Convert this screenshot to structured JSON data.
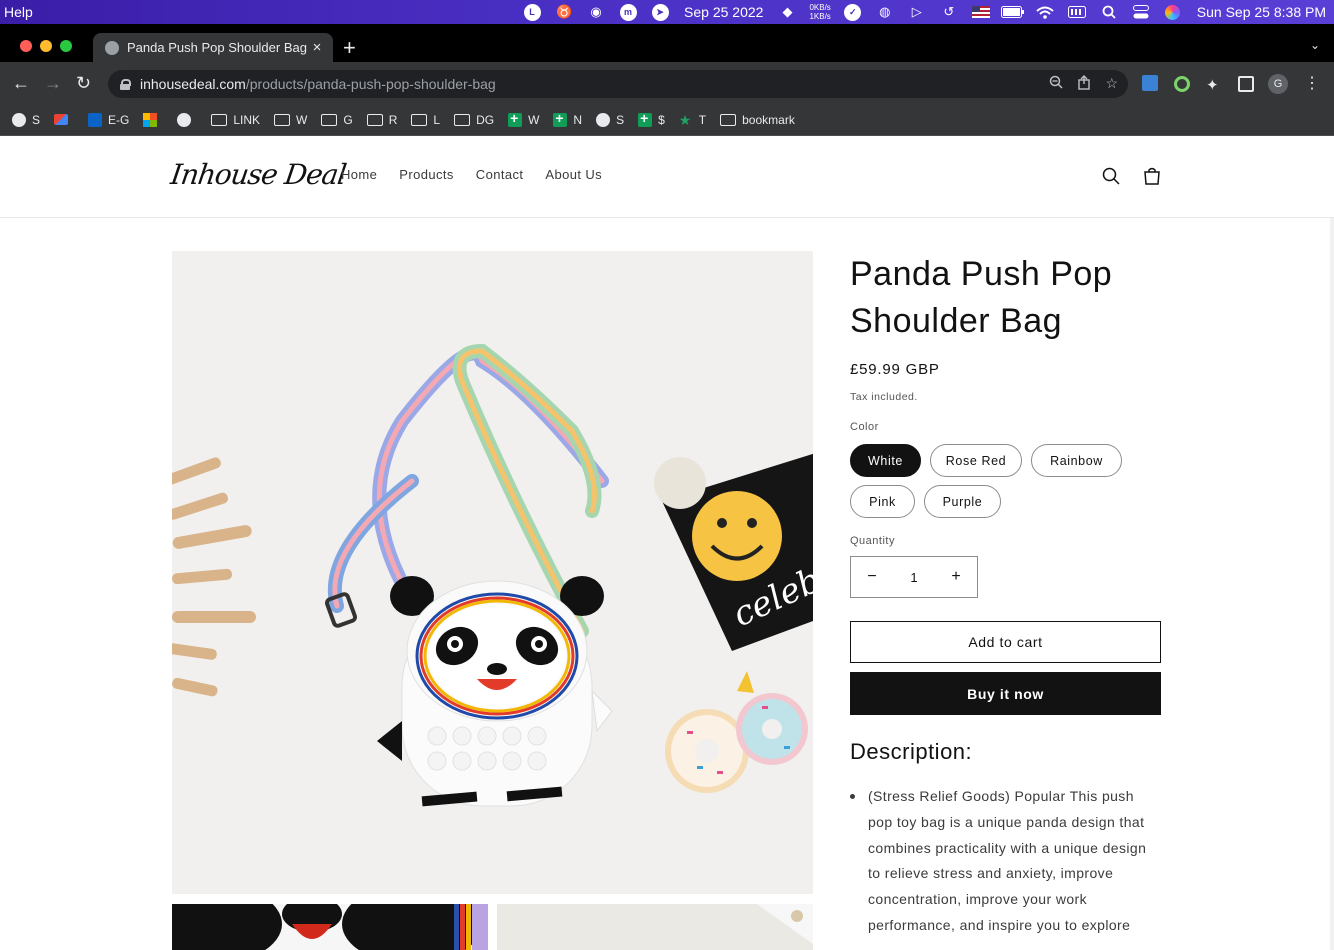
{
  "menubar": {
    "app_menu": "Help",
    "date_short": "Sep 25 2022",
    "net_up": "0KB/s",
    "net_down": "1KB/s",
    "clock": "Sun Sep 25  8:38 PM"
  },
  "browser": {
    "tab_title": "Panda Push Pop Shoulder Bag",
    "url_domain": "inhousedeal.com",
    "url_path": "/products/panda-push-pop-shoulder-bag",
    "profile_initial": "G",
    "bookmarks": [
      {
        "label": "S",
        "icon": "globe"
      },
      {
        "label": "",
        "icon": "gmail"
      },
      {
        "label": "E-G",
        "icon": "outlook"
      },
      {
        "label": "",
        "icon": "ms"
      },
      {
        "label": "",
        "icon": "globe"
      },
      {
        "label": "LINK",
        "icon": "folder"
      },
      {
        "label": "W",
        "icon": "folder"
      },
      {
        "label": "G",
        "icon": "folder"
      },
      {
        "label": "R",
        "icon": "folder"
      },
      {
        "label": "L",
        "icon": "folder"
      },
      {
        "label": "DG",
        "icon": "folder"
      },
      {
        "label": "W",
        "icon": "sheet"
      },
      {
        "label": "N",
        "icon": "sheet"
      },
      {
        "label": "S",
        "icon": "globe"
      },
      {
        "label": "$",
        "icon": "sheet"
      },
      {
        "label": "T",
        "icon": "star"
      },
      {
        "label": "bookmark",
        "icon": "folder"
      }
    ]
  },
  "store": {
    "logo": "Inhouse Deal",
    "nav": [
      "Home",
      "Products",
      "Contact",
      "About Us"
    ]
  },
  "product": {
    "title": "Panda Push Pop Shoulder Bag",
    "price": "£59.99 GBP",
    "tax_note": "Tax included.",
    "color_label": "Color",
    "colors": [
      "White",
      "Rose Red",
      "Rainbow",
      "Pink",
      "Purple"
    ],
    "selected_color": "White",
    "quantity_label": "Quantity",
    "quantity": "1",
    "decrease_symbol": "−",
    "increase_symbol": "+",
    "add_to_cart": "Add to cart",
    "buy_now": "Buy it now",
    "description_heading": "Description:",
    "description_items": [
      "(Stress Relief Goods) Popular This push pop toy bag is a unique panda design that combines practicality with a unique design to relieve stress and anxiety, improve concentration, improve your work performance, and inspire you to explore"
    ],
    "image_text": "celebra"
  }
}
